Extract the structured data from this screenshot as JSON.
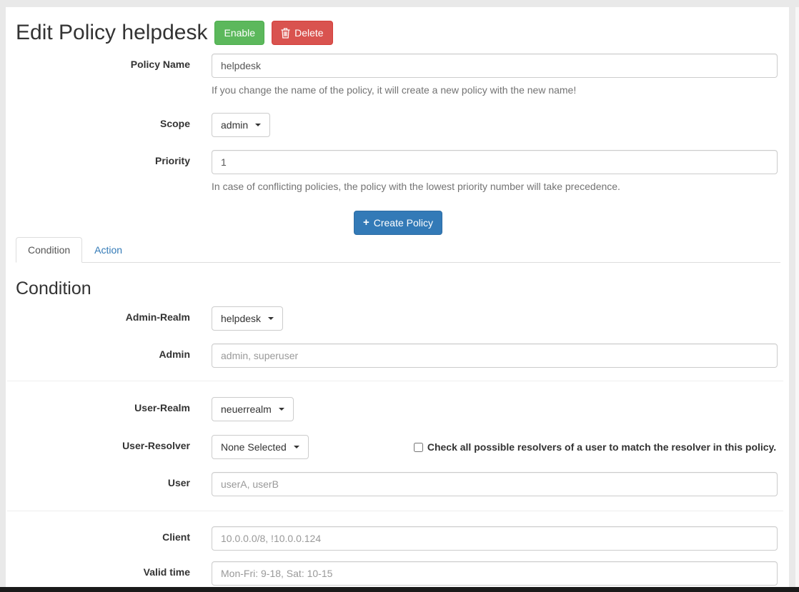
{
  "header": {
    "title": "Edit Policy helpdesk",
    "enable_label": "Enable",
    "delete_label": "Delete"
  },
  "form": {
    "policy_name": {
      "label": "Policy Name",
      "value": "helpdesk",
      "help": "If you change the name of the policy, it will create a new policy with the new name!"
    },
    "scope": {
      "label": "Scope",
      "selected": "admin"
    },
    "priority": {
      "label": "Priority",
      "value": "1",
      "help": "In case of conflicting policies, the policy with the lowest priority number will take precedence."
    },
    "create_button_label": "Create Policy"
  },
  "tabs": [
    {
      "label": "Condition",
      "active": true
    },
    {
      "label": "Action",
      "active": false
    }
  ],
  "condition": {
    "heading": "Condition",
    "admin_realm": {
      "label": "Admin-Realm",
      "selected": "helpdesk"
    },
    "admin": {
      "label": "Admin",
      "placeholder": "admin, superuser"
    },
    "user_realm": {
      "label": "User-Realm",
      "selected": "neuerrealm"
    },
    "user_resolver": {
      "label": "User-Resolver",
      "selected": "None Selected",
      "checkbox_label": "Check all possible resolvers of a user to match the resolver in this policy.",
      "checkbox_checked": false
    },
    "user": {
      "label": "User",
      "placeholder": "userA, userB"
    },
    "client": {
      "label": "Client",
      "placeholder": "10.0.0.0/8, !10.0.0.124"
    },
    "valid_time": {
      "label": "Valid time",
      "placeholder": "Mon-Fri: 9-18, Sat: 10-15"
    }
  },
  "icons": {
    "delete": "trash-icon",
    "create": "plus-icon",
    "dropdown": "caret-down-icon",
    "plus_glyph": "+"
  },
  "colors": {
    "success": "#5cb85c",
    "danger": "#d9534f",
    "primary": "#337ab7",
    "tab_link": "#337ab7",
    "page_margin": "#e9e9e9",
    "bottom_bar": "#1a1a1a"
  }
}
